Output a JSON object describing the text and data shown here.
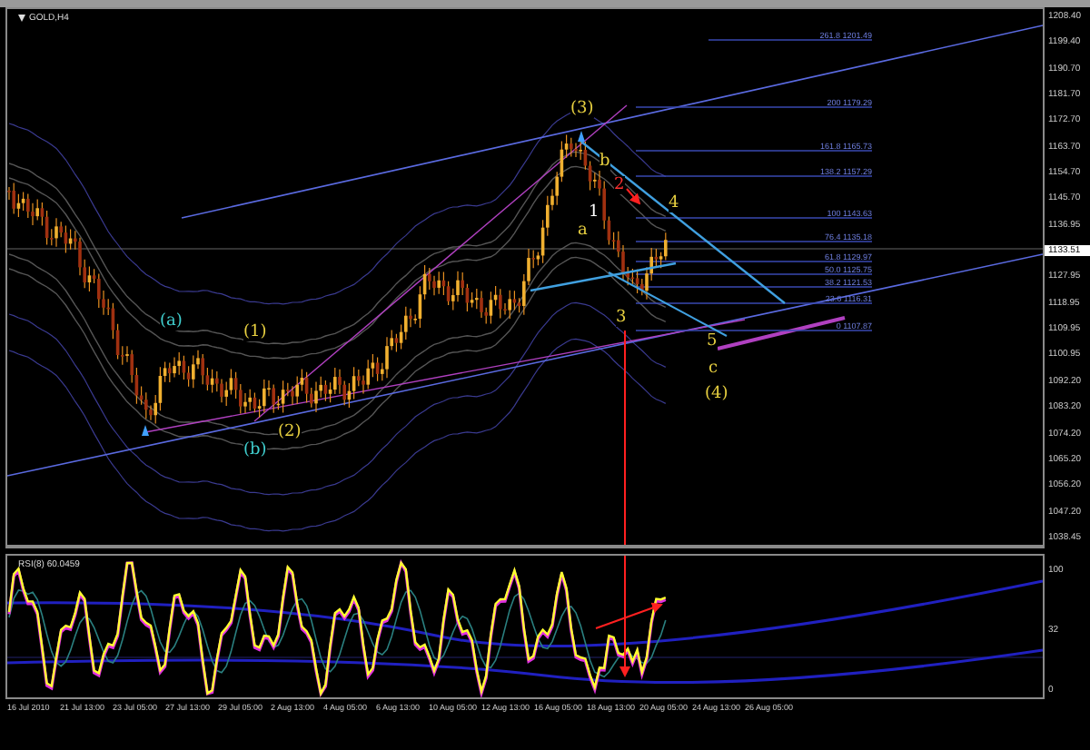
{
  "chart": {
    "title": "GOLD,H4",
    "wave_labels": [
      {
        "text": "(a)",
        "color": "#40d0d0"
      },
      {
        "text": "(b)",
        "color": "#40d0d0"
      },
      {
        "text": "(1)",
        "color": "#e8d040"
      },
      {
        "text": "(2)",
        "color": "#e8d040"
      },
      {
        "text": "(3)",
        "color": "#e8d040"
      },
      {
        "text": "(4)",
        "color": "#e8d040"
      },
      {
        "text": "1",
        "color": "#ffffff"
      },
      {
        "text": "2",
        "color": "#ff3030"
      },
      {
        "text": "a",
        "color": "#e8d040"
      },
      {
        "text": "b",
        "color": "#e8d040"
      },
      {
        "text": "3",
        "color": "#e8d040"
      },
      {
        "text": "4",
        "color": "#e8d040"
      },
      {
        "text": "5",
        "color": "#e8d040"
      },
      {
        "text": "c",
        "color": "#e8d040"
      }
    ],
    "fib_labels": [
      "261.8 1201.49",
      "200 1179.29",
      "161.8 1165.73",
      "138.2 1157.29",
      "100 1143.63",
      "76.4 1135.18",
      "61.8 1129.97",
      "50.0 1125.75",
      "38.2 1121.53",
      "23.6 1116.31",
      "0 1107.87"
    ]
  },
  "price_axis": [
    {
      "text": "1208.40",
      "kind": "tick"
    },
    {
      "text": "1199.40",
      "kind": "tick"
    },
    {
      "text": "1190.70",
      "kind": "tick"
    },
    {
      "text": "1181.70",
      "kind": "tick"
    },
    {
      "text": "1172.70",
      "kind": "tick"
    },
    {
      "text": "1163.70",
      "kind": "tick"
    },
    {
      "text": "1154.70",
      "kind": "tick"
    },
    {
      "text": "1145.70",
      "kind": "tick"
    },
    {
      "text": "1136.95",
      "kind": "tick"
    },
    {
      "text": "1133.51",
      "kind": "current"
    },
    {
      "text": "1127.95",
      "kind": "tick"
    },
    {
      "text": "1118.95",
      "kind": "tick"
    },
    {
      "text": "1109.95",
      "kind": "tick"
    },
    {
      "text": "1100.95",
      "kind": "tick"
    },
    {
      "text": "1092.20",
      "kind": "tick"
    },
    {
      "text": "1083.20",
      "kind": "tick"
    },
    {
      "text": "1074.20",
      "kind": "tick"
    },
    {
      "text": "1065.20",
      "kind": "tick"
    },
    {
      "text": "1056.20",
      "kind": "tick"
    },
    {
      "text": "1047.20",
      "kind": "tick"
    },
    {
      "text": "1038.45",
      "kind": "tick"
    }
  ],
  "rsi": {
    "title": "RSI(8) 60.0459",
    "axis": [
      "100",
      "32",
      "0"
    ]
  },
  "time_axis": [
    "16 Jul 2010",
    "21 Jul 13:00",
    "23 Jul 05:00",
    "27 Jul 13:00",
    "29 Jul 05:00",
    "2 Aug 13:00",
    "4 Aug 05:00",
    "6 Aug 13:00",
    "10 Aug 05:00",
    "12 Aug 13:00",
    "16 Aug 05:00",
    "18 Aug 13:00",
    "20 Aug 05:00",
    "24 Aug 13:00",
    "26 Aug 05:00"
  ]
}
